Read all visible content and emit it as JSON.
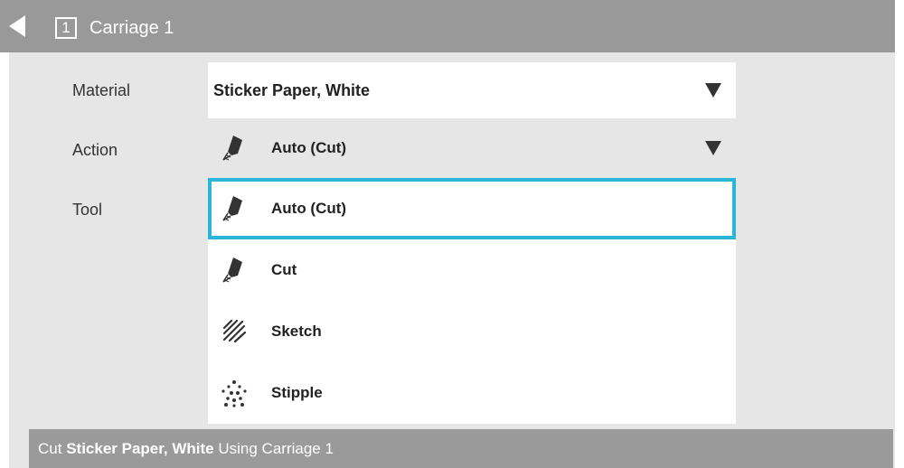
{
  "header": {
    "back_icon": "back-arrow-icon",
    "carriage_number": "1",
    "title": "Carriage 1"
  },
  "labels": {
    "material": "Material",
    "action": "Action",
    "tool": "Tool"
  },
  "material": {
    "selected": "Sticker Paper, White"
  },
  "action": {
    "selected": "Auto (Cut)",
    "selected_icon": "blade-icon",
    "expanded": true,
    "options": [
      {
        "label": "Auto (Cut)",
        "icon": "blade-icon",
        "highlighted": true
      },
      {
        "label": "Cut",
        "icon": "blade-icon",
        "highlighted": false
      },
      {
        "label": "Sketch",
        "icon": "sketch-icon",
        "highlighted": false
      },
      {
        "label": "Stipple",
        "icon": "stipple-icon",
        "highlighted": false
      }
    ]
  },
  "status": {
    "prefix": "Cut ",
    "material": "Sticker Paper, White",
    "suffix": " Using Carriage 1"
  },
  "colors": {
    "header_bg": "#999999",
    "panel_bg": "#e6e6e6",
    "highlight_border": "#2bb6d8",
    "status_bg": "#9a9a9a"
  }
}
